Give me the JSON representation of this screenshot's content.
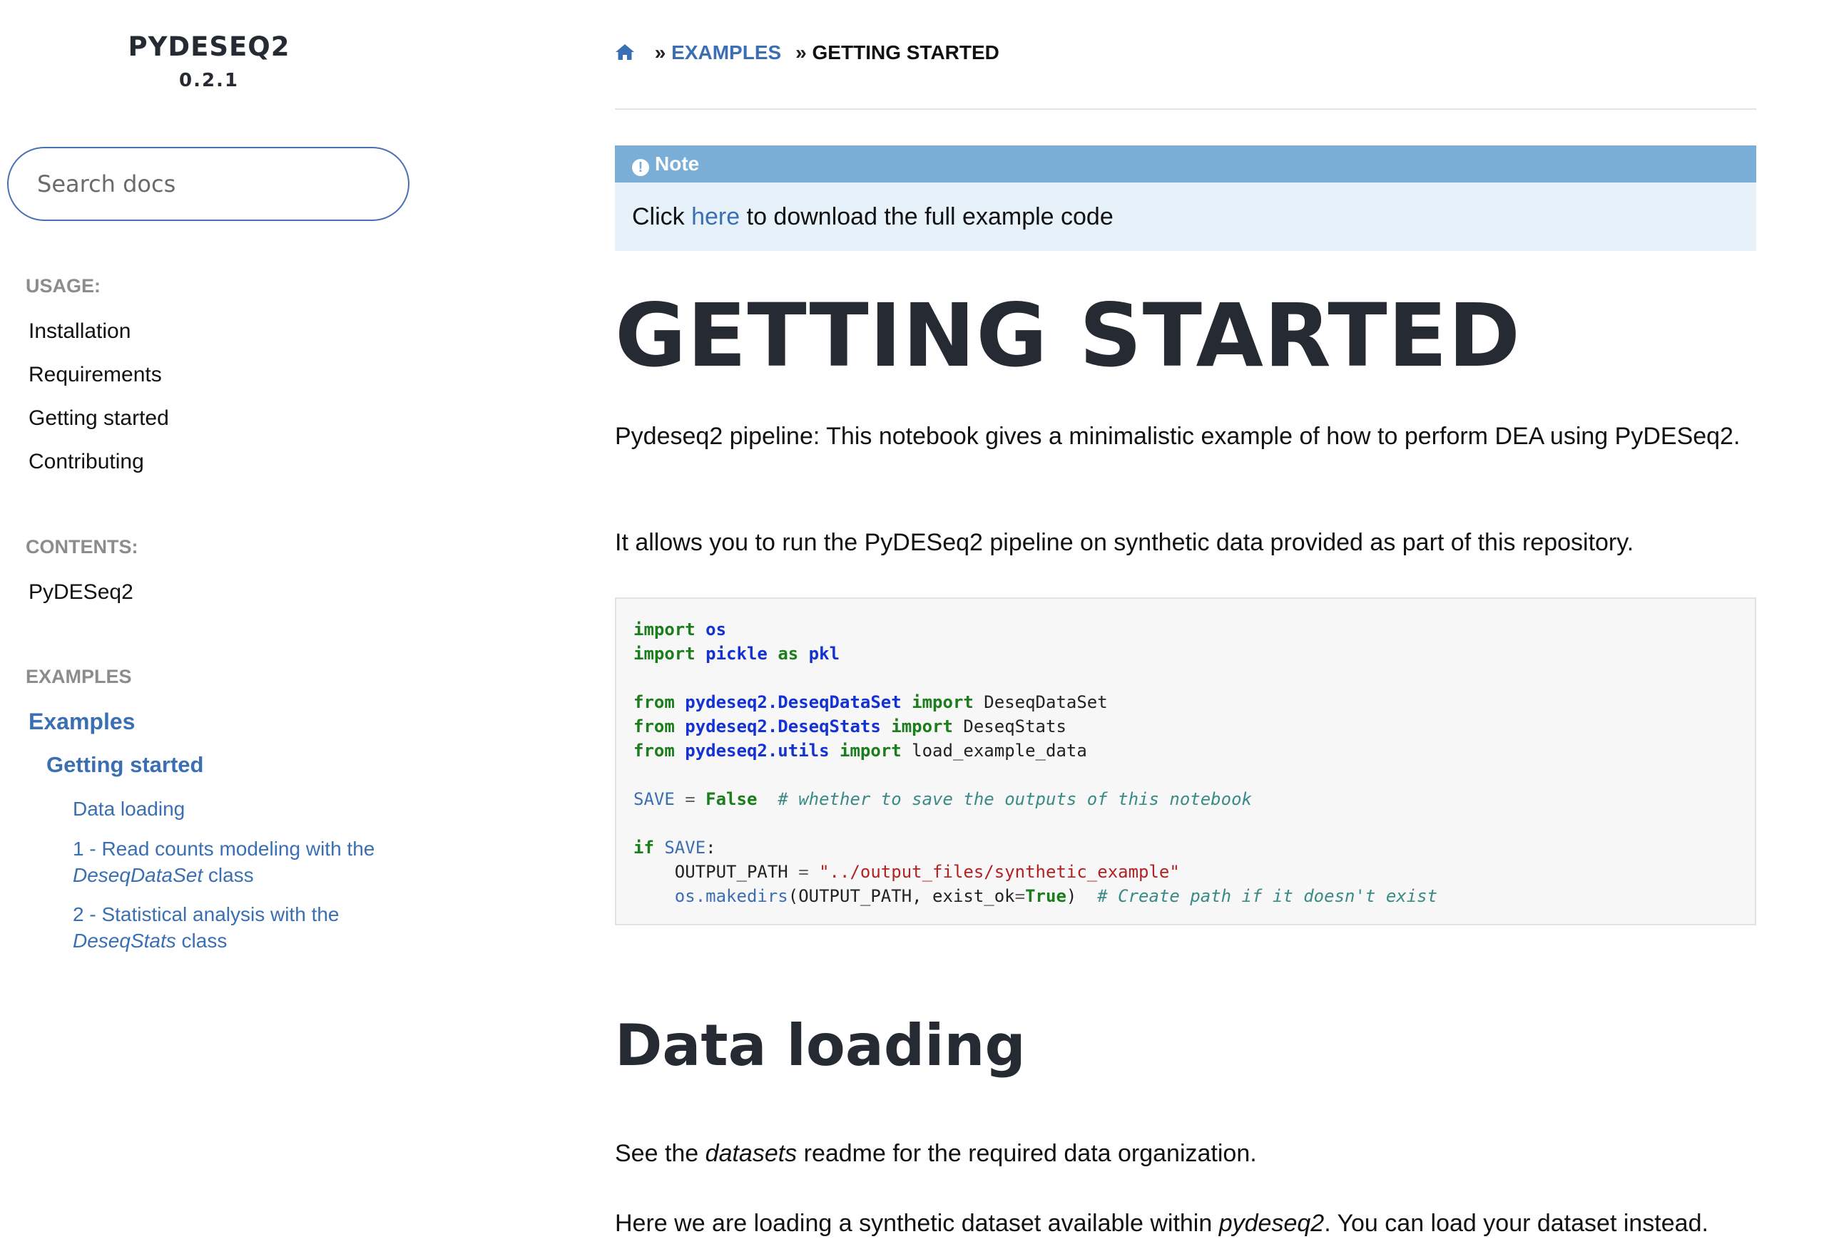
{
  "sidebar": {
    "brand": "PYDESEQ2",
    "version": "0.2.1",
    "search_placeholder": "Search docs",
    "sections": [
      {
        "caption": "USAGE:",
        "items": [
          "Installation",
          "Requirements",
          "Getting started",
          "Contributing"
        ]
      },
      {
        "caption": "CONTENTS:",
        "items": [
          "PyDESeq2"
        ]
      },
      {
        "caption": "EXAMPLES",
        "items": []
      }
    ],
    "examples_tree": {
      "level1": "Examples",
      "level2": "Getting started",
      "level3": [
        {
          "text": "Data loading"
        },
        {
          "line1": "1 - Read counts modeling with the",
          "italic": "DeseqDataSet",
          "tail": " class"
        },
        {
          "line1": "2 - Statistical analysis with the",
          "italic": "DeseqStats",
          "tail": " class"
        }
      ]
    }
  },
  "breadcrumb": {
    "home_icon": "home-icon",
    "sep": "»",
    "link": "EXAMPLES",
    "current": "GETTING STARTED"
  },
  "note": {
    "title": "Note",
    "icon": "exclamation-circle-icon",
    "text_before": "Click ",
    "link": "here",
    "text_after": " to download the full example code"
  },
  "page_title": "GETTING STARTED",
  "intro_1": "Pydeseq2 pipeline: This notebook gives a minimalistic example of how to perform DEA using PyDESeq2.",
  "intro_2": "It allows you to run the PyDESeq2 pipeline on synthetic data provided as part of this repository.",
  "code": {
    "import": "import",
    "from": "from",
    "as": "as",
    "if": "if",
    "os": "os",
    "pickle": "pickle",
    "pkl": "pkl",
    "mod_dds": "pydeseq2.DeseqDataSet",
    "mod_ds": "pydeseq2.DeseqStats",
    "mod_utils": "pydeseq2.utils",
    "cls_dds": "DeseqDataSet",
    "cls_ds": "DeseqStats",
    "fn_load": "load_example_data",
    "save": "SAVE",
    "eq": "=",
    "false": "False",
    "true": "True",
    "comment_save": "# whether to save the outputs of this notebook",
    "colon": ":",
    "output_path": "OUTPUT_PATH",
    "path_str": "\"../output_files/synthetic_example\"",
    "os_makedirs": "os.makedirs",
    "makedirs_args": "(OUTPUT_PATH, exist_ok",
    "close_paren": ")",
    "comment_path": "# Create path if it doesn't exist"
  },
  "section_title": "Data loading",
  "data_para_1": {
    "before": "See the ",
    "italic": "datasets",
    "after": " readme for the required data organization."
  },
  "data_para_2": {
    "before": "Here we are loading a synthetic dataset available within ",
    "italic": "pydeseq2",
    "after": ". You can load your dataset instead."
  }
}
